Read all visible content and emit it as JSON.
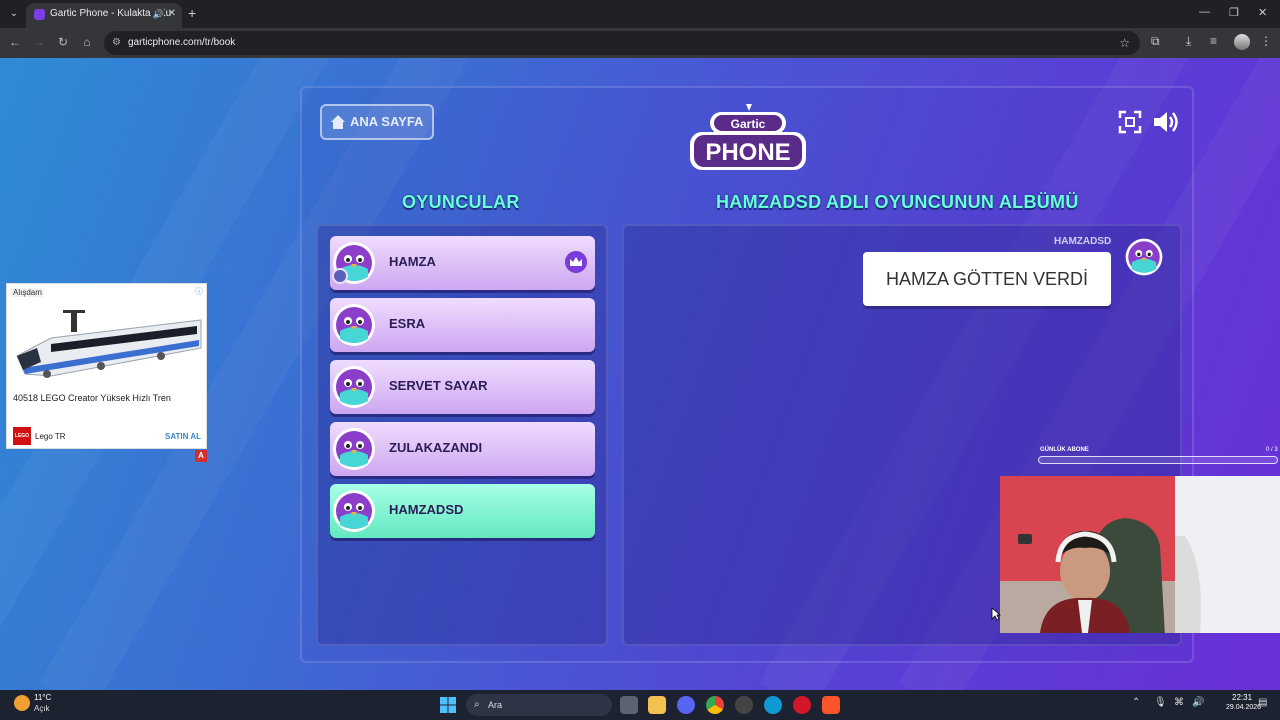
{
  "browser": {
    "tab_title": "Gartic Phone - Kulaktan Ku",
    "url": "garticphone.com/tr/book"
  },
  "ad": {
    "label": "Alışdam",
    "title": "40518 LEGO Creator Yüksek Hızlı Tren",
    "brand": "Lego TR",
    "cta": "SATIN AL",
    "badge": "A",
    "logo": "LEGO"
  },
  "game": {
    "home_label": "ANA SAYFA",
    "logo_top": "Gartic",
    "logo_bottom": "PHONE",
    "players_title": "OYUNCULAR",
    "album_title": "HAMZADSD ADLI OYUNCUNUN ALBÜMÜ",
    "players": [
      {
        "name": "HAMZA",
        "host": true,
        "active": false
      },
      {
        "name": "ESRA",
        "host": false,
        "active": false
      },
      {
        "name": "SERVET SAYAR",
        "host": false,
        "active": false
      },
      {
        "name": "ZULAKAZANDI",
        "host": false,
        "active": false
      },
      {
        "name": "HAMZADSD",
        "host": false,
        "active": true
      }
    ],
    "album": {
      "author": "HAMZADSD",
      "message": "HAMZA GÖTTEN VERDİ"
    },
    "colors": {
      "accent_title": "#66ffd9",
      "player_card": "#e3c8fb",
      "active_card": "#7cf0cc"
    }
  },
  "overlay": {
    "sub_label": "GÜNLÜK ABONE",
    "sub_count": "0 / 3",
    "sub_progress": 0
  },
  "taskbar": {
    "temp": "11°C",
    "weather": "Açık",
    "search_placeholder": "Ara",
    "time": "22:31",
    "date": "29.04.2026"
  }
}
